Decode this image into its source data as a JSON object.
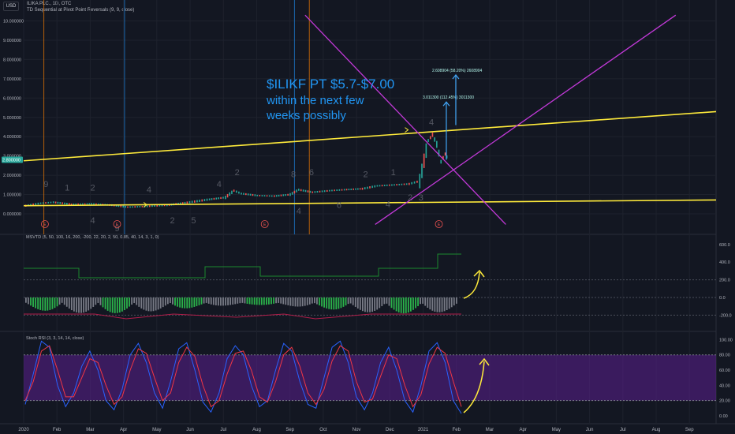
{
  "header": {
    "currency_badge": "USD",
    "symbol_line": "ILIKA PLC., 1D, OTC",
    "study_line": "TD Sequential at Pivot Point Reversals (9, 9, close)"
  },
  "annotation": {
    "line1": "$ILIKF PT $5.7-$7.00",
    "line2": "within the next few",
    "line3": "weeks possibly"
  },
  "colors": {
    "background": "#131722",
    "note_blue": "#2196f3",
    "trend_yellow": "#ffeb3b",
    "fan_magenta": "#c239d8",
    "up_green": "#26a69a",
    "down_red": "#ef5350",
    "stoch_band": "#5b1f8f",
    "stoch_k": "#2962ff",
    "stoch_d": "#f23645",
    "msvtd_green": "#1b8a2f",
    "msvtd_red": "#b01e4a"
  },
  "chart_data": [
    {
      "type": "line",
      "pane": "price",
      "title": "ILIKA PLC., 1D, OTC",
      "y_ticks": [
        "0.000000",
        "1.000000",
        "2.000000",
        "3.000000",
        "4.000000",
        "5.000000",
        "6.000000",
        "7.000000",
        "8.000000",
        "9.000000",
        "10.000000"
      ],
      "ylim": [
        -0.55,
        10.3
      ],
      "last_price_label": "2.800000",
      "x_ticks": [
        "2020",
        "Feb",
        "Mar",
        "Apr",
        "May",
        "Jun",
        "Jul",
        "Aug",
        "Sep",
        "Oct",
        "Nov",
        "Dec",
        "2021",
        "Feb",
        "Mar",
        "Apr",
        "May",
        "Jun",
        "Jul",
        "Aug",
        "Sep"
      ],
      "series": [
        {
          "x": [
            "2019-12-20",
            "2020-01-03",
            "2020-01-15",
            "2020-02-01",
            "2020-02-20",
            "2020-03-10",
            "2020-03-25",
            "2020-04-10",
            "2020-05-01",
            "2020-05-20",
            "2020-06-10",
            "2020-06-25",
            "2020-07-03",
            "2020-07-10",
            "2020-07-25",
            "2020-08-10",
            "2020-08-25",
            "2020-09-02",
            "2020-09-15",
            "2020-10-01",
            "2020-10-15",
            "2020-11-01",
            "2020-11-15",
            "2020-12-01",
            "2020-12-15",
            "2020-12-25",
            "2021-01-02",
            "2021-01-06",
            "2021-01-10",
            "2021-01-14",
            "2021-01-18",
            "2021-01-21"
          ],
          "y": [
            0.42,
            0.55,
            0.6,
            0.5,
            0.52,
            0.45,
            0.35,
            0.38,
            0.45,
            0.58,
            0.75,
            0.85,
            1.2,
            1.05,
            0.95,
            0.92,
            1.0,
            1.25,
            1.12,
            1.2,
            1.25,
            1.3,
            1.45,
            1.5,
            1.55,
            1.7,
            3.8,
            4.1,
            3.6,
            2.7,
            3.1,
            2.8
          ]
        }
      ],
      "trendlines": [
        {
          "name": "upper",
          "color": "#ffeb3b",
          "from": [
            "2019-12-18",
            2.75
          ],
          "to": [
            "2021-09-30",
            5.3
          ]
        },
        {
          "name": "lower",
          "color": "#ffeb3b",
          "from": [
            "2019-12-18",
            0.42
          ],
          "to": [
            "2021-09-30",
            0.72
          ]
        }
      ],
      "fan_lines": [
        {
          "from": [
            "2020-09-08",
            10.3
          ],
          "to": [
            "2021-03-16",
            -0.55
          ]
        },
        {
          "from": [
            "2020-11-13",
            -0.55
          ],
          "to": [
            "2021-08-23",
            10.3
          ]
        }
      ],
      "td_counts": [
        {
          "x": "2020-01-08",
          "y": 1.4,
          "label": "9",
          "side": "up"
        },
        {
          "x": "2020-01-28",
          "y": 1.2,
          "label": "1",
          "side": "up"
        },
        {
          "x": "2020-02-21",
          "y": 1.2,
          "label": "2",
          "side": "up"
        },
        {
          "x": "2020-02-21",
          "y": -0.5,
          "label": "4",
          "side": "down"
        },
        {
          "x": "2020-03-15",
          "y": -0.9,
          "label": "9",
          "side": "down"
        },
        {
          "x": "2020-04-14",
          "y": 1.1,
          "label": "4",
          "side": "up"
        },
        {
          "x": "2020-05-06",
          "y": -0.5,
          "label": "2",
          "side": "down"
        },
        {
          "x": "2020-05-26",
          "y": -0.5,
          "label": "5",
          "side": "down"
        },
        {
          "x": "2020-06-19",
          "y": 1.4,
          "label": "4",
          "side": "up"
        },
        {
          "x": "2020-07-06",
          "y": 2.0,
          "label": "2",
          "side": "up"
        },
        {
          "x": "2020-08-28",
          "y": 1.9,
          "label": "8",
          "side": "up"
        },
        {
          "x": "2020-09-14",
          "y": 2.0,
          "label": "6",
          "side": "up"
        },
        {
          "x": "2020-09-02",
          "y": 0.0,
          "label": "4",
          "side": "down"
        },
        {
          "x": "2020-11-04",
          "y": 1.9,
          "label": "2",
          "side": "up"
        },
        {
          "x": "2020-10-10",
          "y": 0.3,
          "label": "6",
          "side": "down"
        },
        {
          "x": "2020-11-30",
          "y": 2.0,
          "label": "1",
          "side": "up"
        },
        {
          "x": "2020-11-25",
          "y": 0.35,
          "label": "4",
          "side": "down"
        },
        {
          "x": "2020-12-16",
          "y": 0.7,
          "label": "2",
          "side": "down"
        },
        {
          "x": "2020-12-26",
          "y": 0.7,
          "label": "3",
          "side": "down"
        },
        {
          "x": "2021-01-05",
          "y": 4.6,
          "label": "4",
          "side": "up"
        }
      ],
      "earnings_markers": [
        "2020-01-07",
        "2020-03-15",
        "2020-08-01",
        "2021-01-12"
      ],
      "projections": [
        {
          "label": "3.011300 (112.45%) 3011300",
          "from": 2.8,
          "to": 5.8
        },
        {
          "label": "2.608904 (58.20%) 2608904",
          "from": 4.6,
          "to": 7.2
        }
      ],
      "cycle_lines": [
        {
          "x": "2020-01-06",
          "color": "#f57c00"
        },
        {
          "x": "2020-03-22",
          "color": "#1e88e5"
        },
        {
          "x": "2020-08-29",
          "color": "#1e88e5"
        },
        {
          "x": "2020-09-12",
          "color": "#f57c00"
        }
      ]
    },
    {
      "type": "bar",
      "pane": "msvtd",
      "title": "MSVTD (5, 50, 100, 16, 200, -200, 22, 20, 2, 50, 0.85, 40, 14, 3, 1, 0)",
      "y_ticks": [
        "600.0",
        "400.0",
        "200.0",
        "0.0",
        "-200.0"
      ],
      "ylim": [
        -350,
        680
      ],
      "upper_level": 200,
      "lower_level": -200,
      "bars_note": "oscillator histogram, gray/green bars"
    },
    {
      "type": "line",
      "pane": "stoch_rsi",
      "title": "Stoch RSI (3, 3, 14, 14, close)",
      "y_ticks": [
        "100.00",
        "80.00",
        "60.00",
        "40.00",
        "20.00",
        "0.00"
      ],
      "ylim": [
        -5,
        105
      ],
      "band": [
        20,
        80
      ],
      "series": [
        {
          "name": "K",
          "color": "#2962ff",
          "values": [
            15,
            55,
            98,
            90,
            40,
            12,
            30,
            65,
            85,
            60,
            20,
            8,
            35,
            80,
            95,
            70,
            30,
            10,
            45,
            88,
            96,
            60,
            18,
            5,
            30,
            75,
            92,
            80,
            40,
            12,
            20,
            60,
            95,
            85,
            45,
            15,
            10,
            50,
            90,
            98,
            70,
            25,
            8,
            30,
            70,
            90,
            60,
            20,
            5,
            40,
            85,
            96,
            70,
            20,
            3
          ]
        },
        {
          "name": "D",
          "color": "#f23645",
          "values": [
            20,
            45,
            85,
            92,
            60,
            25,
            25,
            50,
            75,
            70,
            40,
            15,
            25,
            60,
            88,
            82,
            50,
            20,
            30,
            70,
            90,
            78,
            40,
            12,
            20,
            55,
            82,
            85,
            60,
            25,
            18,
            45,
            80,
            90,
            65,
            30,
            15,
            35,
            72,
            92,
            85,
            45,
            18,
            22,
            52,
            80,
            75,
            40,
            12,
            28,
            68,
            90,
            82,
            45,
            12
          ]
        }
      ]
    }
  ]
}
